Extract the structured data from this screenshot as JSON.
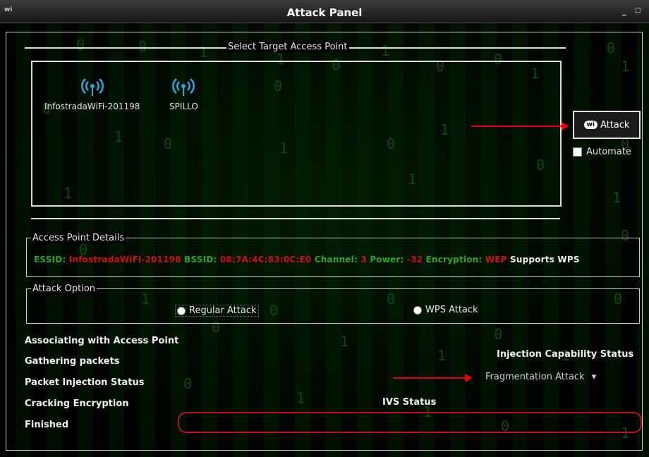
{
  "window": {
    "logo": "wi",
    "title": "Attack Panel",
    "minimize": "_",
    "maximize": "□"
  },
  "select_target": {
    "label": "Select Target Access Point",
    "access_points": [
      {
        "name": "InfostradaWiFi-201198",
        "icon": "wifi-signal-icon"
      },
      {
        "name": "SPILLO",
        "icon": "wifi-signal-icon"
      }
    ]
  },
  "attack_button": {
    "label": "Attack",
    "logo": "wi"
  },
  "automate": {
    "label": "Automate",
    "checked": false
  },
  "details": {
    "label": "Access Point Details",
    "essid_label": "ESSID:",
    "essid": "InfostradaWiFi-201198",
    "bssid_label": "BSSID:",
    "bssid": "08:7A:4C:83:0C:E0",
    "channel_label": "Channel:",
    "channel": "3",
    "power_label": "Power:",
    "power": "-32",
    "encryption_label": "Encryption:",
    "encryption": "WEP",
    "wps": "Supports WPS"
  },
  "attack_option": {
    "label": "Attack Option",
    "regular": "Regular Attack",
    "wps": "WPS  Attack",
    "selected": "regular"
  },
  "status": {
    "items": [
      "Associating with Access Point",
      "Gathering packets",
      "Packet Injection Status",
      "Cracking Encryption",
      "Finished"
    ]
  },
  "injection": {
    "title": "Injection Capability Status",
    "selected": "Fragmentation Attack",
    "arrow": "▾"
  },
  "ivs": {
    "title": "IVS Status"
  },
  "colors": {
    "label_green": "#2ba62b",
    "value_red": "#d01010",
    "bar_red": "#c01010",
    "annotation_arrow": "#e00000"
  }
}
